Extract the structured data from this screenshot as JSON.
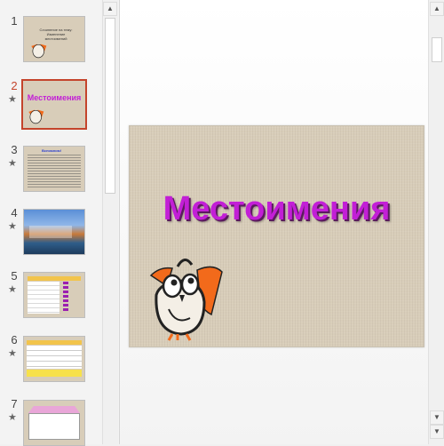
{
  "thumbnails": [
    {
      "number": "1",
      "starred": false,
      "active": false,
      "title": "Сочинение на тему: Изменение местоимений"
    },
    {
      "number": "2",
      "starred": true,
      "active": true,
      "title": "Местоимения"
    },
    {
      "number": "3",
      "starred": true,
      "active": false,
      "title": "Вспомним!"
    },
    {
      "number": "4",
      "starred": true,
      "active": false,
      "title": ""
    },
    {
      "number": "5",
      "starred": true,
      "active": false,
      "title": ""
    },
    {
      "number": "6",
      "starred": true,
      "active": false,
      "title": ""
    },
    {
      "number": "7",
      "starred": true,
      "active": false,
      "title": ""
    }
  ],
  "slide": {
    "title": "Местоимения",
    "title_color": "#c21fd6",
    "background": "#d8cdb9"
  },
  "colors": {
    "active_accent": "#c4442b",
    "owl_orange": "#f26a1b"
  },
  "icons": {
    "star": "★",
    "scroll_up": "▲",
    "scroll_down": "▼"
  }
}
